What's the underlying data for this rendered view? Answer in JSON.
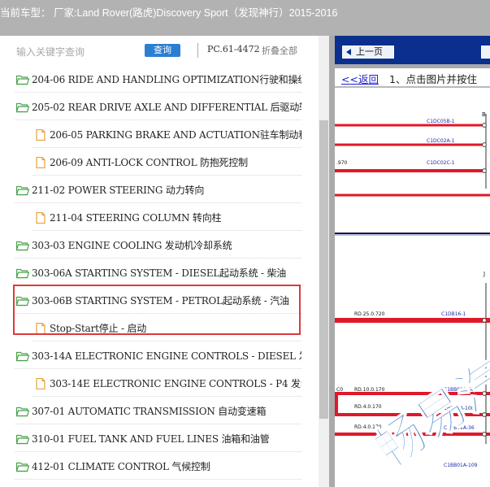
{
  "header": {
    "title": "当前车型：  厂家:Land Rover(路虎)Discovery Sport（发现神行）2015-2016"
  },
  "search": {
    "placeholder": "输入关键字查询",
    "button_label": "查询",
    "pc_number": "PC.61-4472",
    "collapse_all": "折叠全部"
  },
  "tree": {
    "items": [
      {
        "level": 0,
        "label": "204-06 RIDE AND HANDLING OPTIMIZATION行驶和操纵优化"
      },
      {
        "level": 0,
        "label": "205-02 REAR DRIVE AXLE AND DIFFERENTIAL 后驱动轴和差速器"
      },
      {
        "level": 1,
        "label": "206-05 PARKING BRAKE AND ACTUATION驻车制动和作动"
      },
      {
        "level": 1,
        "label": "206-09 ANTI-LOCK CONTROL 防抱死控制"
      },
      {
        "level": 0,
        "label": "211-02 POWER STEERING 动力转向"
      },
      {
        "level": 1,
        "label": "211-04 STEERING COLUMN 转向柱"
      },
      {
        "level": 0,
        "label": "303-03 ENGINE COOLING 发动机冷却系统"
      },
      {
        "level": 0,
        "label": "303-06A STARTING SYSTEM - DIESEL起动系统 - 柴油"
      },
      {
        "level": 0,
        "label": "303-06B STARTING SYSTEM - PETROL起动系统 - 汽油"
      },
      {
        "level": 1,
        "label": "Stop-Start停止 - 启动"
      },
      {
        "level": 0,
        "label": "303-14A ELECTRONIC ENGINE CONTROLS - DIESEL 发动机电子控制"
      },
      {
        "level": 1,
        "label": "303-14E ELECTRONIC ENGINE CONTROLS - P4 发动机电子控制"
      },
      {
        "level": 0,
        "label": "307-01 AUTOMATIC TRANSMISSION 自动变速箱"
      },
      {
        "level": 0,
        "label": "310-01 FUEL TANK AND FUEL LINES 油箱和油管"
      },
      {
        "level": 0,
        "label": "412-01 CLIMATE CONTROL 气候控制"
      },
      {
        "level": 0,
        "label": ""
      }
    ]
  },
  "viewer": {
    "prev_label": "上一页",
    "back_link": "<<返回",
    "instruction": " 1、点击图片并按住",
    "watermark": "畅易汽",
    "diagram_labels": {
      "c1dc05b": "C1DC05B-1",
      "c1dc02a": "C1DC02A-1",
      "c1dc02c": "C1DC02C-1",
      "left_970": ".970",
      "b_mark": "B",
      "j_mark": "J",
      "rd25": "RD.25.0.720",
      "c1db16": "C1DB16-1",
      "co": "C0",
      "rd10": "RD.10.0.170",
      "rd4a": "RD.4.0.170",
      "rd4b": "RD.4.0.170",
      "c1bb01a66": "C1BB01A-66",
      "c1bb01a108": "C1BB01A-108",
      "c1bb01a36": "C1BB01A-36",
      "c1bb01a109": "C1BB01A-109"
    }
  },
  "colors": {
    "header_bg": "#b2b2b2",
    "query_button": "#2b7fd1",
    "highlight_border": "#dc3a3a",
    "nav_bar": "#0b2f8e",
    "wire_red": "#e0182a",
    "watermark": "#3a7ec8",
    "folder_green": "#4aa14a",
    "doc_orange": "#e8a23a"
  }
}
